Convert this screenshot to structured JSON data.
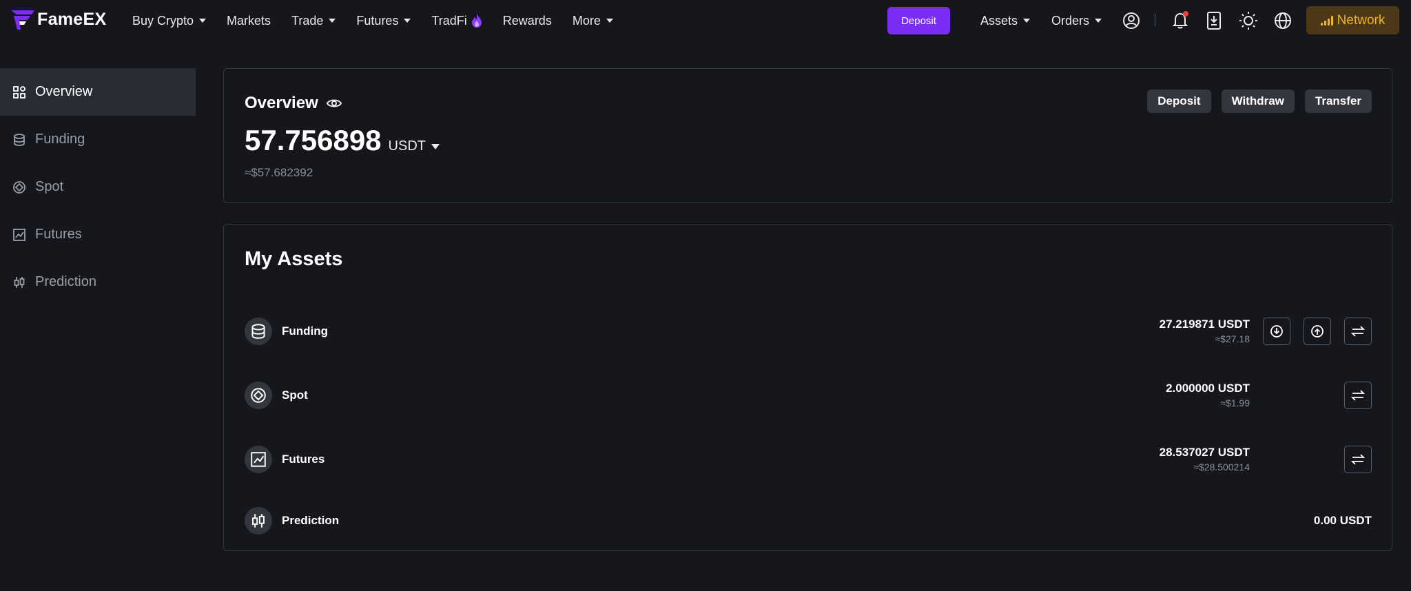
{
  "brand": {
    "name": "FameEX",
    "accent": "#7b2cf5"
  },
  "nav": {
    "buy_crypto": "Buy Crypto",
    "markets": "Markets",
    "trade": "Trade",
    "futures": "Futures",
    "tradfi": "TradFi",
    "rewards": "Rewards",
    "more": "More"
  },
  "header_right": {
    "deposit": "Deposit",
    "assets": "Assets",
    "orders": "Orders",
    "network": "Network",
    "icons": [
      "user-icon",
      "bell-icon",
      "download-app-icon",
      "sun-icon",
      "globe-icon"
    ]
  },
  "sidebar": {
    "items": [
      {
        "label": "Overview",
        "icon": "grid-icon",
        "active": true
      },
      {
        "label": "Funding",
        "icon": "database-icon",
        "active": false
      },
      {
        "label": "Spot",
        "icon": "spot-icon",
        "active": false
      },
      {
        "label": "Futures",
        "icon": "chart-icon",
        "active": false
      },
      {
        "label": "Prediction",
        "icon": "candlestick-icon",
        "active": false
      }
    ]
  },
  "overview": {
    "title": "Overview",
    "amount": "57.756898",
    "unit": "USDT",
    "approx": "≈$57.682392",
    "actions": {
      "deposit": "Deposit",
      "withdraw": "Withdraw",
      "transfer": "Transfer"
    }
  },
  "my_assets": {
    "title": "My Assets",
    "rows": [
      {
        "name": "Funding",
        "usdt": "27.219871 USDT",
        "usd": "≈$27.18"
      },
      {
        "name": "Spot",
        "usdt": "2.000000 USDT",
        "usd": "≈$1.99"
      },
      {
        "name": "Futures",
        "usdt": "28.537027 USDT",
        "usd": "≈$28.500214"
      },
      {
        "name": "Prediction",
        "usdt": "0.00 USDT",
        "usd": ""
      }
    ]
  }
}
